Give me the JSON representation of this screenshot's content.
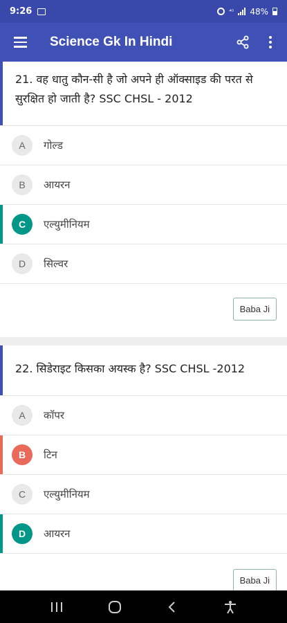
{
  "status_bar": {
    "time": "9:26",
    "battery": "48%"
  },
  "app_bar": {
    "title": "Science Gk In Hindi"
  },
  "questions": [
    {
      "text": "21. वह धातु कौन-सी है जो अपने ही ऑक्साइड की परत से सुरक्षित हो जाती है? SSC CHSL - 2012",
      "options": [
        {
          "letter": "A",
          "text": "गोल्ड",
          "state": "normal"
        },
        {
          "letter": "B",
          "text": "आयरन",
          "state": "normal"
        },
        {
          "letter": "C",
          "text": "एल्युमीनियम",
          "state": "correct"
        },
        {
          "letter": "D",
          "text": "सिल्वर",
          "state": "normal"
        }
      ],
      "button_label": "Baba Ji"
    },
    {
      "text": "22. सिडेराइट किसका अयस्क है? SSC CHSL -2012",
      "options": [
        {
          "letter": "A",
          "text": "कॉपर",
          "state": "normal"
        },
        {
          "letter": "B",
          "text": "टिन",
          "state": "wrong"
        },
        {
          "letter": "C",
          "text": "एल्युमीनियम",
          "state": "normal"
        },
        {
          "letter": "D",
          "text": "आयरन",
          "state": "correct"
        }
      ],
      "button_label": "Baba Ji"
    }
  ],
  "colors": {
    "primary": "#3f51b5",
    "status": "#3949ab",
    "correct": "#009688",
    "wrong": "#e96a5a"
  }
}
